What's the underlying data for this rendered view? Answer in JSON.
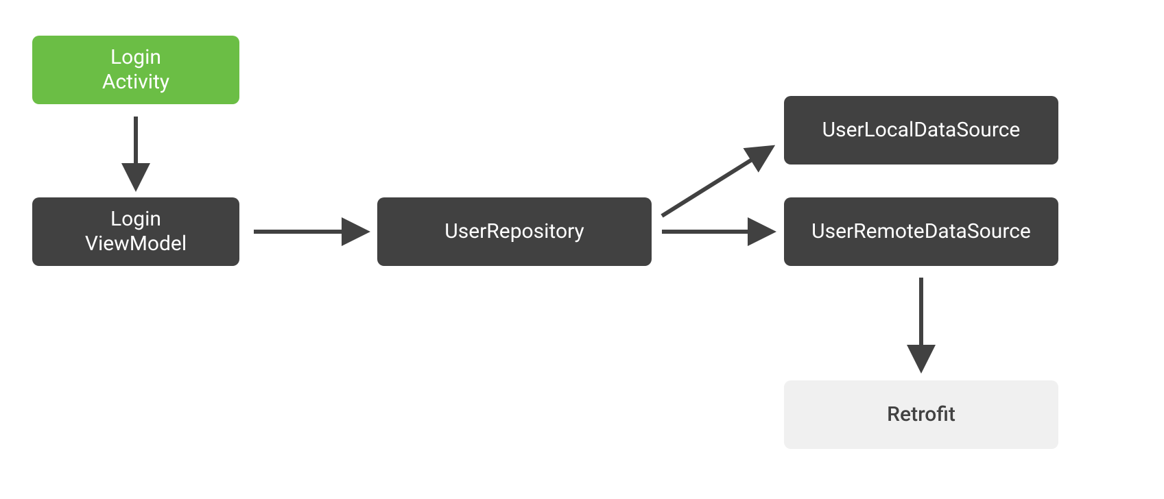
{
  "nodes": {
    "login_activity": {
      "label": "Login\nActivity"
    },
    "login_viewmodel": {
      "label": "Login\nViewModel"
    },
    "user_repository": {
      "label": "UserRepository"
    },
    "user_local_ds": {
      "label": "UserLocalDataSource"
    },
    "user_remote_ds": {
      "label": "UserRemoteDataSource"
    },
    "retrofit": {
      "label": "Retrofit"
    }
  },
  "colors": {
    "green": "#6bbe45",
    "dark": "#414141",
    "light": "#f0f0f0",
    "arrow": "#414141"
  },
  "edges": [
    {
      "from": "login_activity",
      "to": "login_viewmodel"
    },
    {
      "from": "login_viewmodel",
      "to": "user_repository"
    },
    {
      "from": "user_repository",
      "to": "user_local_ds"
    },
    {
      "from": "user_repository",
      "to": "user_remote_ds"
    },
    {
      "from": "user_remote_ds",
      "to": "retrofit"
    }
  ]
}
